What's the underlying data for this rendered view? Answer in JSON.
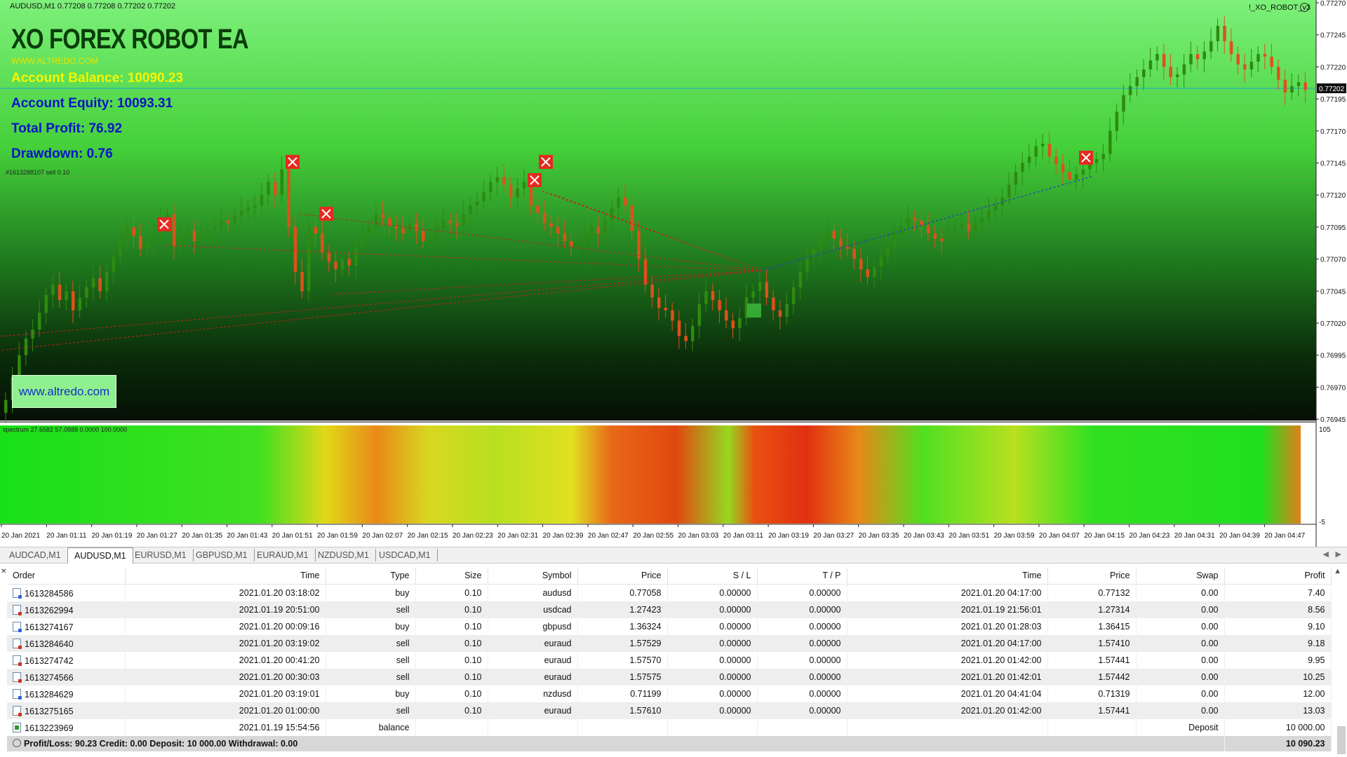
{
  "chart": {
    "symbol_line": "AUDUSD,M1  0.77208 0.77208 0.77202 0.77202",
    "ea_name": "!_XO_ROBOT_v3",
    "title": "XO FOREX ROBOT EA",
    "site": "WWW.ALTREDO.COM",
    "balance": "Account Balance: 10090.23",
    "equity": "Account Equity: 10093.31",
    "profit": "Total Profit: 76.92",
    "drawdown": "Drawdown: 0.76",
    "trade_label": "#1613288107 sell 0.10",
    "site_button": "www.altredo.com",
    "current_price": "0.77202",
    "price_labels": [
      "0.77270",
      "0.77245",
      "0.77220",
      "0.77195",
      "0.77170",
      "0.77145",
      "0.77120",
      "0.77095",
      "0.77070",
      "0.77045",
      "0.77020",
      "0.76995",
      "0.76970",
      "0.76945"
    ],
    "spectrum_label": "spectrum 27.6582 57.0888 0.0000 100.0000",
    "spectrum_scale": [
      "105",
      "-5"
    ],
    "time_labels": [
      "20 Jan 2021",
      "20 Jan 01:11",
      "20 Jan 01:19",
      "20 Jan 01:27",
      "20 Jan 01:35",
      "20 Jan 01:43",
      "20 Jan 01:51",
      "20 Jan 01:59",
      "20 Jan 02:07",
      "20 Jan 02:15",
      "20 Jan 02:23",
      "20 Jan 02:31",
      "20 Jan 02:39",
      "20 Jan 02:47",
      "20 Jan 02:55",
      "20 Jan 03:03",
      "20 Jan 03:11",
      "20 Jan 03:19",
      "20 Jan 03:27",
      "20 Jan 03:35",
      "20 Jan 03:43",
      "20 Jan 03:51",
      "20 Jan 03:59",
      "20 Jan 04:07",
      "20 Jan 04:15",
      "20 Jan 04:23",
      "20 Jan 04:31",
      "20 Jan 04:39",
      "20 Jan 04:47"
    ],
    "closes": [
      0.7696,
      0.76978,
      0.76995,
      0.77008,
      0.77015,
      0.77028,
      0.77042,
      0.7705,
      0.77038,
      0.77045,
      0.7703,
      0.7704,
      0.77048,
      0.77055,
      0.77045,
      0.7706,
      0.77072,
      0.77085,
      0.77095,
      0.77088,
      0.77078,
      0.77082,
      0.7709,
      0.771,
      0.77105,
      0.7708,
      0.77088,
      0.77092,
      0.77084,
      0.77088,
      0.77092,
      0.77096,
      0.771,
      0.77098,
      0.77104,
      0.77108,
      0.7711,
      0.77112,
      0.7712,
      0.7713,
      0.7712,
      0.7714,
      0.77095,
      0.7706,
      0.77045,
      0.77095,
      0.7709,
      0.77075,
      0.77068,
      0.77062,
      0.7707,
      0.77065,
      0.7708,
      0.7709,
      0.77095,
      0.77105,
      0.77102,
      0.77096,
      0.77094,
      0.7709,
      0.77098,
      0.77092,
      0.77084,
      0.77086,
      0.77094,
      0.771,
      0.77098,
      0.77096,
      0.77105,
      0.77112,
      0.77115,
      0.77122,
      0.7713,
      0.77134,
      0.77128,
      0.77118,
      0.77125,
      0.7713,
      0.77112,
      0.77106,
      0.77098,
      0.77095,
      0.7709,
      0.77084,
      0.7708,
      0.77082,
      0.77088,
      0.77095,
      0.7709,
      0.771,
      0.7711,
      0.77118,
      0.77112,
      0.77092,
      0.7707,
      0.7705,
      0.7704,
      0.77032,
      0.7703,
      0.77022,
      0.7701,
      0.77006,
      0.77018,
      0.77035,
      0.77045,
      0.77038,
      0.7703,
      0.77022,
      0.77016,
      0.77024,
      0.7704,
      0.77045,
      0.77052,
      0.7704,
      0.7703,
      0.77025,
      0.77035,
      0.77048,
      0.7706,
      0.77072,
      0.77078,
      0.77085,
      0.77092,
      0.77086,
      0.7708,
      0.77078,
      0.7707,
      0.77062,
      0.77056,
      0.77064,
      0.77072,
      0.7708,
      0.7709,
      0.77096,
      0.77102,
      0.771,
      0.77096,
      0.7709,
      0.77086,
      0.77084,
      0.7709,
      0.77095,
      0.77098,
      0.77092,
      0.77098,
      0.77102,
      0.77108,
      0.77112,
      0.77118,
      0.77128,
      0.77138,
      0.77145,
      0.7715,
      0.77158,
      0.7716,
      0.7715,
      0.77144,
      0.77138,
      0.77132,
      0.77136,
      0.7714,
      0.77145,
      0.77148,
      0.77152,
      0.7717,
      0.77185,
      0.77198,
      0.77205,
      0.77212,
      0.77218,
      0.77225,
      0.7723,
      0.7722,
      0.77212,
      0.77214,
      0.77222,
      0.7723,
      0.77226,
      0.77232,
      0.7724,
      0.77252,
      0.7724,
      0.7723,
      0.77222,
      0.77218,
      0.77224,
      0.7723,
      0.77228,
      0.7722,
      0.7721,
      0.772,
      0.77205,
      0.77208,
      0.77202
    ]
  },
  "tabs": [
    "AUDCAD,M1",
    "AUDUSD,M1",
    "EURUSD,M1",
    "GBPUSD,M1",
    "EURAUD,M1",
    "NZDUSD,M1",
    "USDCAD,M1"
  ],
  "active_tab": "AUDUSD,M1",
  "table": {
    "headers": [
      "Order",
      "Time",
      "Type",
      "Size",
      "Symbol",
      "Price",
      "S / L",
      "T / P",
      "Time",
      "Price",
      "Swap",
      "Profit"
    ],
    "rows": [
      [
        "1613284586",
        "2021.01.20 03:18:02",
        "buy",
        "0.10",
        "audusd",
        "0.77058",
        "0.00000",
        "0.00000",
        "2021.01.20 04:17:00",
        "0.77132",
        "0.00",
        "7.40"
      ],
      [
        "1613262994",
        "2021.01.19 20:51:00",
        "sell",
        "0.10",
        "usdcad",
        "1.27423",
        "0.00000",
        "0.00000",
        "2021.01.19 21:56:01",
        "1.27314",
        "0.00",
        "8.56"
      ],
      [
        "1613274167",
        "2021.01.20 00:09:16",
        "buy",
        "0.10",
        "gbpusd",
        "1.36324",
        "0.00000",
        "0.00000",
        "2021.01.20 01:28:03",
        "1.36415",
        "0.00",
        "9.10"
      ],
      [
        "1613284640",
        "2021.01.20 03:19:02",
        "sell",
        "0.10",
        "euraud",
        "1.57529",
        "0.00000",
        "0.00000",
        "2021.01.20 04:17:00",
        "1.57410",
        "0.00",
        "9.18"
      ],
      [
        "1613274742",
        "2021.01.20 00:41:20",
        "sell",
        "0.10",
        "euraud",
        "1.57570",
        "0.00000",
        "0.00000",
        "2021.01.20 01:42:00",
        "1.57441",
        "0.00",
        "9.95"
      ],
      [
        "1613274566",
        "2021.01.20 00:30:03",
        "sell",
        "0.10",
        "euraud",
        "1.57575",
        "0.00000",
        "0.00000",
        "2021.01.20 01:42:01",
        "1.57442",
        "0.00",
        "10.25"
      ],
      [
        "1613284629",
        "2021.01.20 03:19:01",
        "buy",
        "0.10",
        "nzdusd",
        "0.71199",
        "0.00000",
        "0.00000",
        "2021.01.20 04:41:04",
        "0.71319",
        "0.00",
        "12.00"
      ],
      [
        "1613275165",
        "2021.01.20 01:00:00",
        "sell",
        "0.10",
        "euraud",
        "1.57610",
        "0.00000",
        "0.00000",
        "2021.01.20 01:42:00",
        "1.57441",
        "0.00",
        "13.03"
      ]
    ],
    "balance_row": {
      "order": "1613223969",
      "time": "2021.01.19 15:54:56",
      "type": "balance",
      "label": "Deposit",
      "amount": "10 000.00"
    },
    "summary": {
      "text": "Profit/Loss: 90.23  Credit: 0.00  Deposit: 10 000.00  Withdrawal: 0.00",
      "total": "10 090.23"
    }
  },
  "colors": {
    "bull": "#2e8b10",
    "bear": "#e0501a",
    "hline": "#2ab0c0",
    "close_marker": "#e32b1f"
  }
}
